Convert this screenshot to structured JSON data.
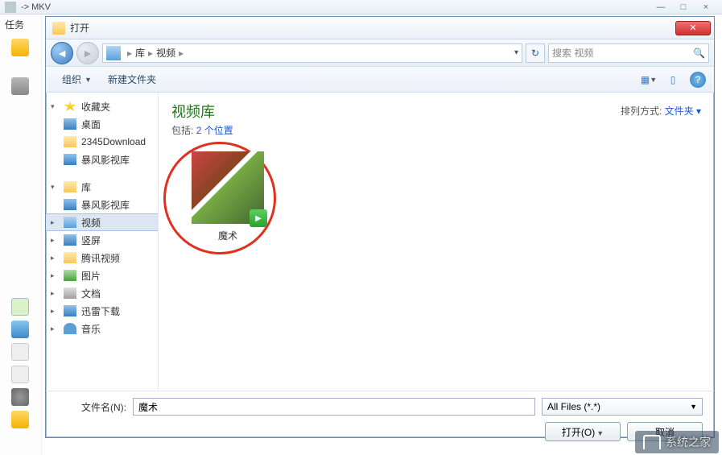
{
  "parent": {
    "title": "-> MKV",
    "task_label": "任务"
  },
  "dialog": {
    "title": "打开",
    "breadcrumb": {
      "root": "库",
      "current": "视频"
    },
    "refresh_icon": "↻",
    "search_placeholder": "搜索 视频",
    "toolbar": {
      "organize": "组织",
      "newfolder": "新建文件夹"
    },
    "sidebar": {
      "favorites": {
        "label": "收藏夹",
        "items": [
          "桌面",
          "2345Download",
          "暴风影视库"
        ]
      },
      "libraries": {
        "label": "库",
        "items": [
          "暴风影视库",
          "视频",
          "竖屏",
          "腾讯视频",
          "图片",
          "文档",
          "迅雷下载",
          "音乐"
        ],
        "selected_index": 1
      }
    },
    "content": {
      "heading": "视频库",
      "includes_label": "包括:",
      "includes_link": "2 个位置",
      "sort_label": "排列方式:",
      "sort_value": "文件夹",
      "thumb_label": "魔术"
    },
    "footer": {
      "filename_label": "文件名(N):",
      "filename_value": "魔术",
      "filetype": "All Files (*.*)",
      "open_btn": "打开(O)",
      "cancel_btn": "取消"
    }
  },
  "watermark": "系统之家"
}
